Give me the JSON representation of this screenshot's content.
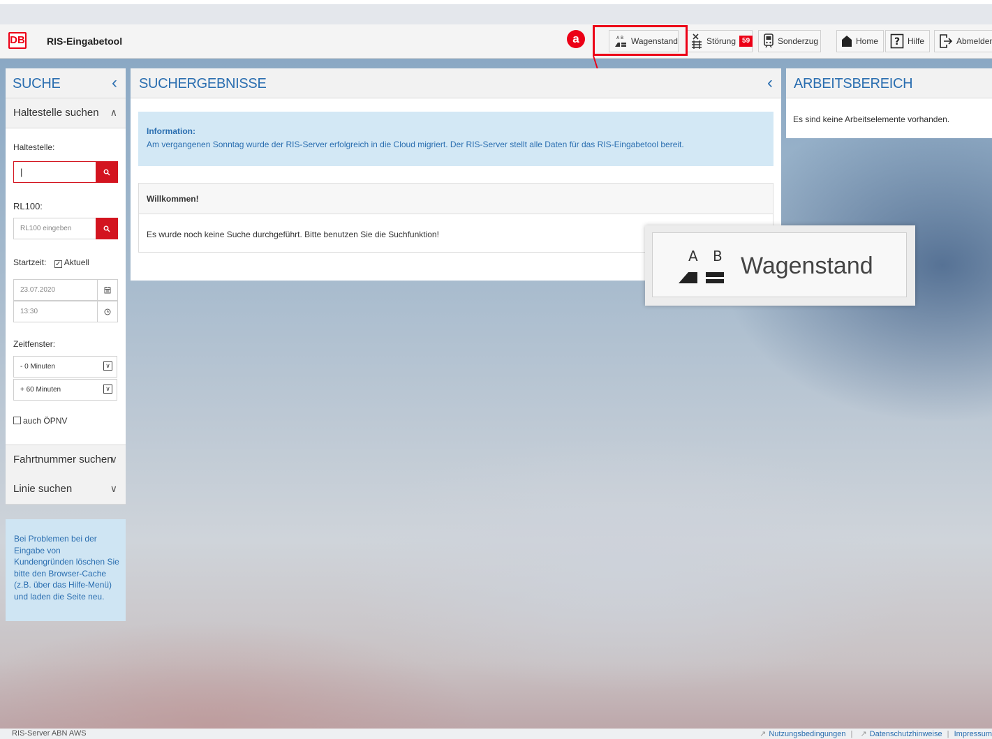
{
  "header": {
    "logo_text": "DB",
    "app_title": "RIS-Eingabetool",
    "buttons": {
      "wagenstand": "Wagenstand",
      "stoerung": "Störung",
      "stoerung_badge": "59",
      "sonderzug": "Sonderzug",
      "home": "Home",
      "hilfe": "Hilfe",
      "abmelden": "Abmelden"
    },
    "wagenstand_icon_letters": "A B"
  },
  "annotation": {
    "marker": "a",
    "zoom_label": "Wagenstand",
    "zoom_letters": "A B",
    "color": "#ec0016"
  },
  "suche": {
    "title": "SUCHE",
    "haltestelle_section": "Haltestelle suchen",
    "haltestelle_label": "Haltestelle:",
    "haltestelle_value": "|",
    "rl100_label": "RL100:",
    "rl100_placeholder": "RL100 eingeben",
    "startzeit_label": "Startzeit:",
    "aktuell_label": "Aktuell",
    "aktuell_checked": true,
    "date": "23.07.2020",
    "time": "13:30",
    "zeitfenster_label": "Zeitfenster:",
    "zeitfenster_minus": "- 0 Minuten",
    "zeitfenster_plus": "+ 60 Minuten",
    "oepnv_label": "auch ÖPNV",
    "fahrtnummer_section": "Fahrtnummer suchen",
    "linie_section": "Linie suchen",
    "hint": "Bei Problemen bei der Eingabe von Kundengründen löschen Sie bitte den Browser-Cache (z.B. über das Hilfe-Menü) und laden die Seite neu."
  },
  "suchergebnisse": {
    "title": "SUCHERGEBNISSE",
    "info_title": "Information:",
    "info_text": "Am vergangenen Sonntag wurde der RIS-Server erfolgreich in die Cloud migriert. Der RIS-Server stellt alle Daten für das RIS-Eingabetool bereit.",
    "welcome_title": "Willkommen!",
    "welcome_text": "Es wurde noch keine Suche durchgeführt. Bitte benutzen Sie die Suchfunktion!"
  },
  "arbeitsbereich": {
    "title": "ARBEITSBEREICH",
    "empty_text": "Es sind keine Arbeitselemente vorhanden."
  },
  "footer": {
    "server": "RIS-Server ABN AWS",
    "links": [
      "Nutzungsbedingungen",
      "Datenschutzhinweise",
      "Impressum"
    ]
  },
  "colors": {
    "accent": "#2a6eb0",
    "brand_red": "#ec0016"
  }
}
